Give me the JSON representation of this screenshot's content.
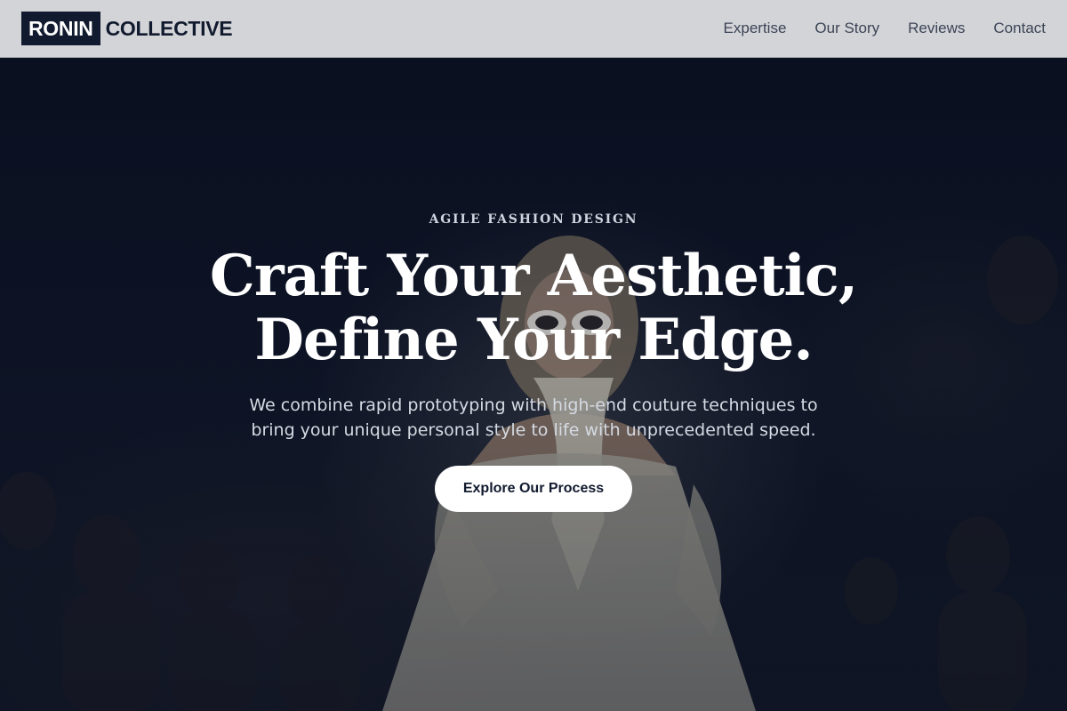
{
  "header": {
    "logo_primary": "RONIN",
    "logo_secondary": "COLLECTIVE",
    "nav": [
      {
        "label": "Expertise"
      },
      {
        "label": "Our Story"
      },
      {
        "label": "Reviews"
      },
      {
        "label": "Contact"
      }
    ]
  },
  "hero": {
    "eyebrow": "AGILE FASHION DESIGN",
    "headline_line1": "Craft Your Aesthetic,",
    "headline_line2": "Define Your Edge.",
    "subtext_line1": "We combine rapid prototyping with high-end couture techniques to",
    "subtext_line2": "bring your unique personal style to life with unprecedented speed.",
    "cta_label": "Explore Our Process",
    "background_image": "runway-model-photo"
  },
  "colors": {
    "header_bg": "#d3d4d8",
    "brand_dark": "#111a2e",
    "hero_bg": "#0b1120",
    "cta_bg": "#ffffff"
  }
}
